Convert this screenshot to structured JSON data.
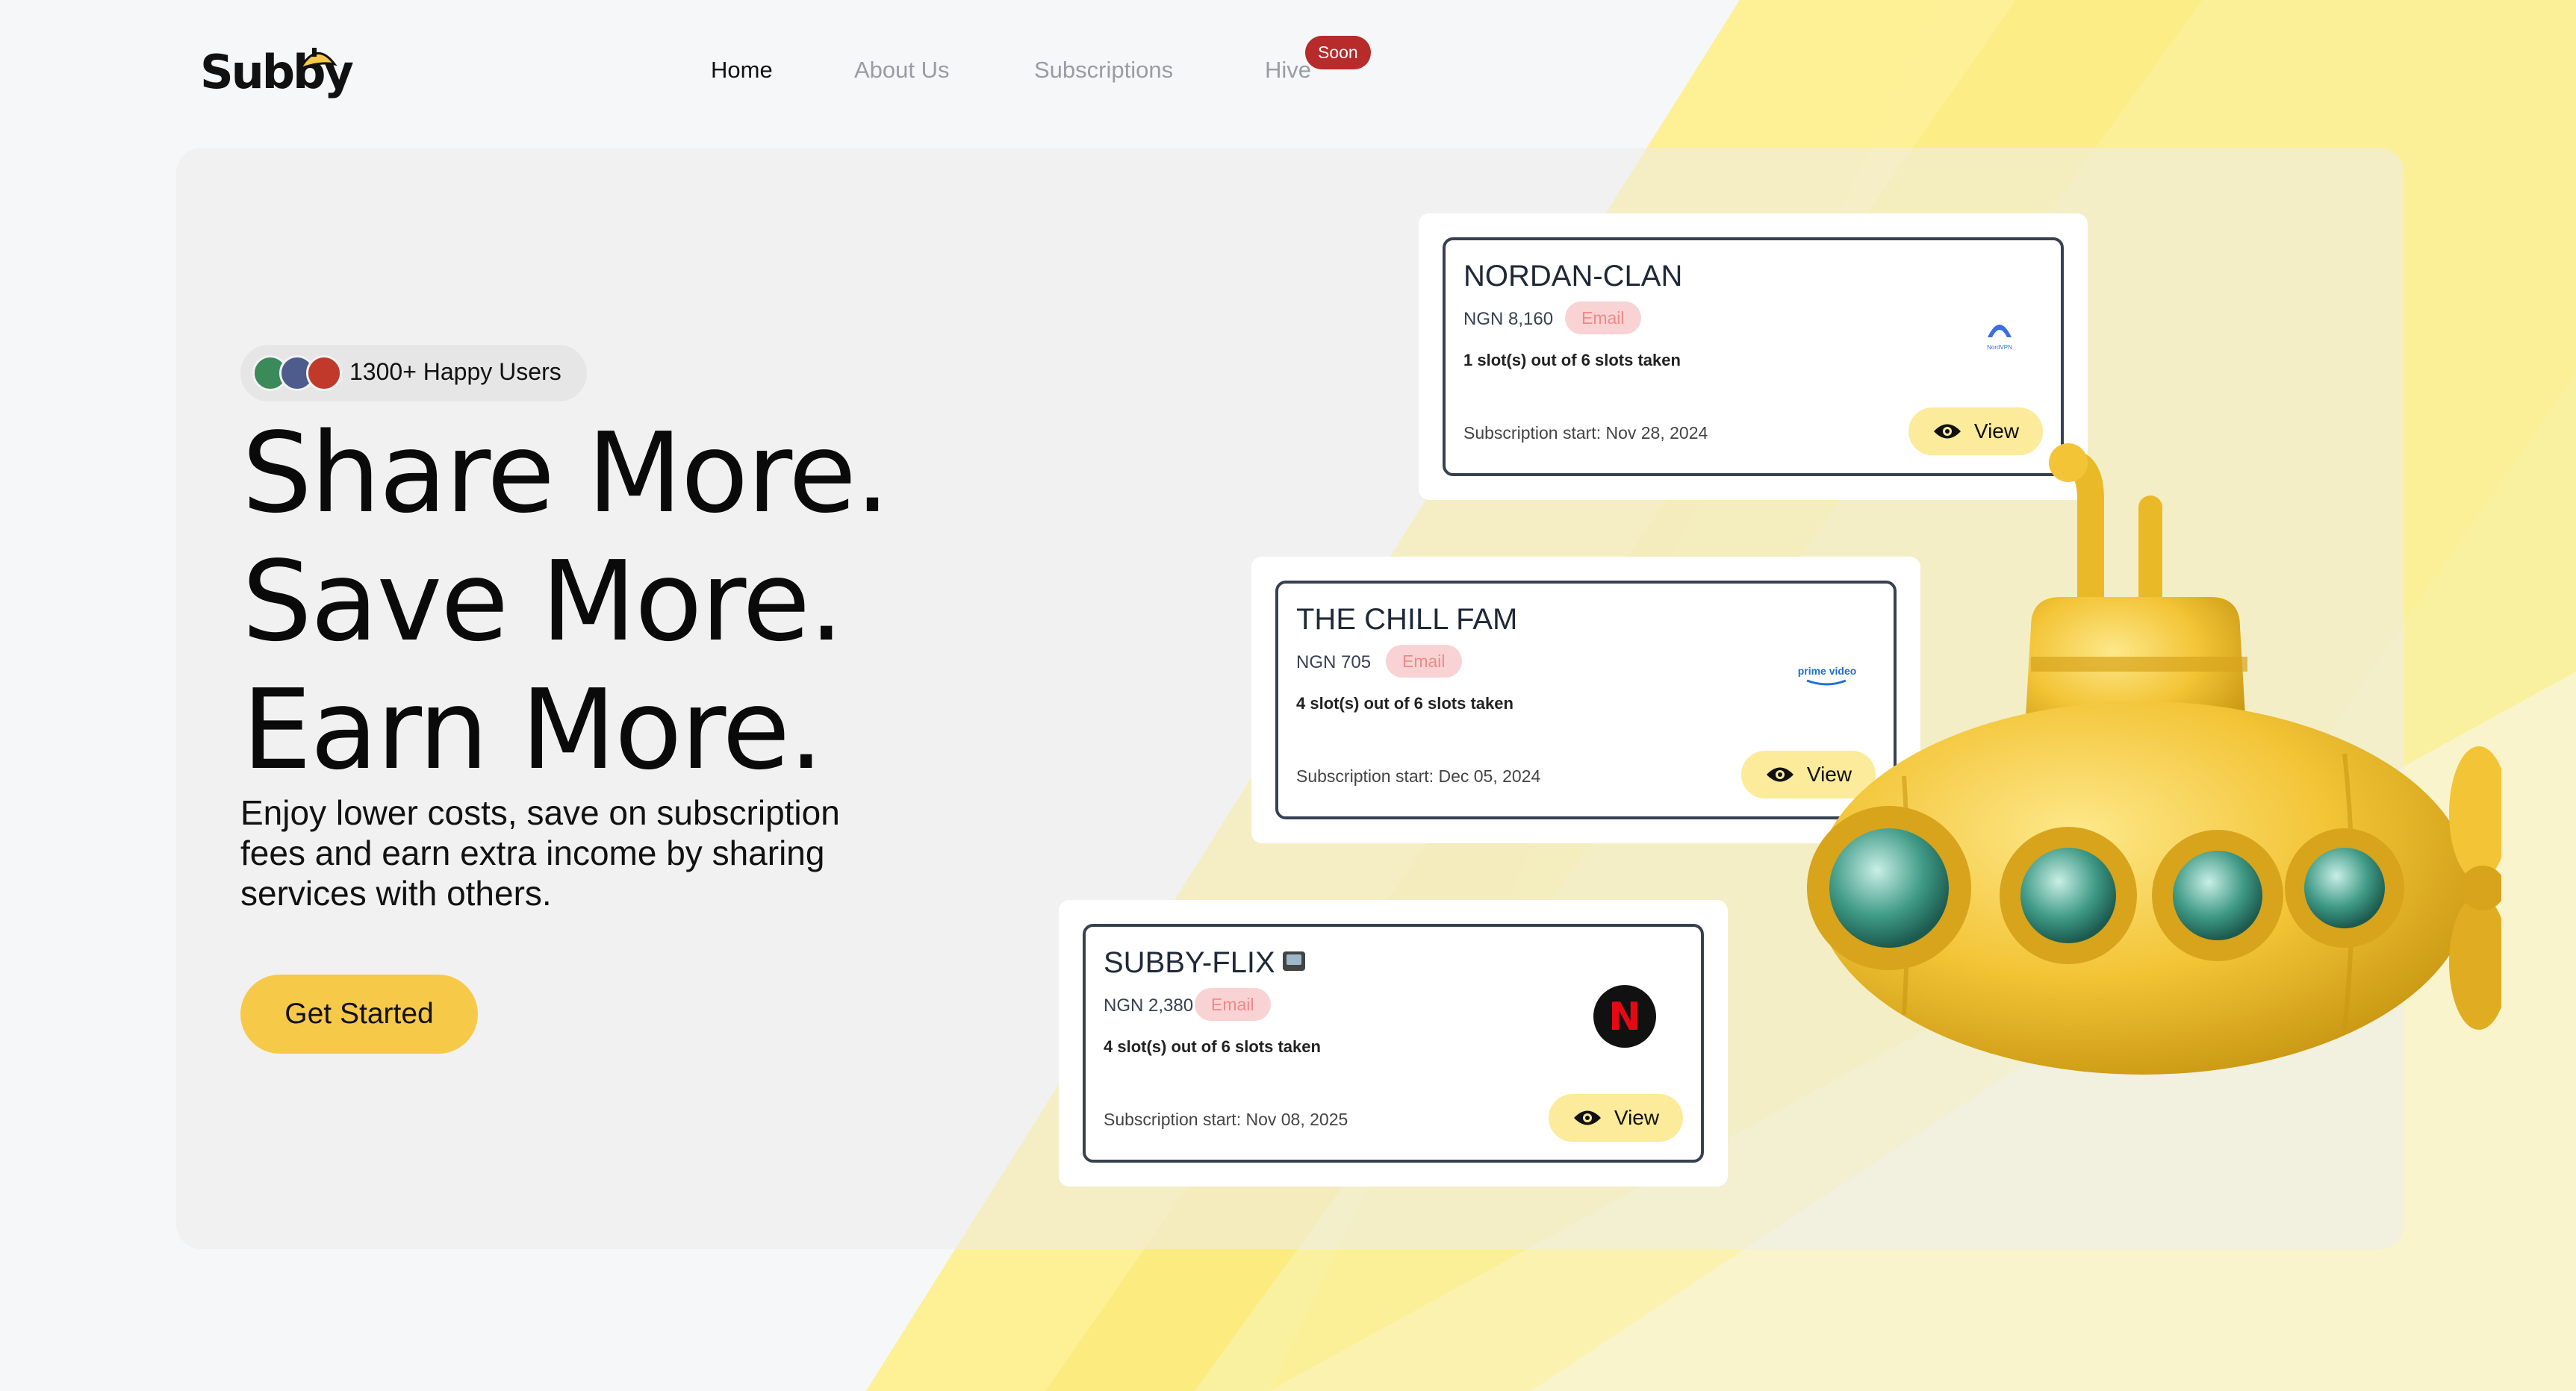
{
  "brand": {
    "name": "Subby"
  },
  "nav": {
    "items": [
      {
        "label": "Home",
        "active": true
      },
      {
        "label": "About Us",
        "active": false
      },
      {
        "label": "Subscriptions",
        "active": false
      },
      {
        "label": "Hive",
        "active": false
      }
    ],
    "badge": "Soon"
  },
  "hero": {
    "users_label": "1300+ Happy Users",
    "headline": [
      "Share More.",
      "Save More.",
      "Earn More."
    ],
    "subtext": "Enjoy lower costs, save on subscription fees and earn extra income by sharing services with others.",
    "cta_label": "Get Started"
  },
  "cards": [
    {
      "title": "NORDAN-CLAN",
      "price": "NGN 8,160",
      "tag": "Email",
      "slots": "1 slot(s) out of 6 slots taken",
      "start": "Subscription start: Nov 28, 2024",
      "view_label": "View",
      "logo": "nordvpn-logo",
      "logo_text": "NordVPN"
    },
    {
      "title": "THE CHILL FAM",
      "price": "NGN 705",
      "tag": "Email",
      "slots": "4 slot(s) out of 6 slots taken",
      "start": "Subscription start: Dec 05, 2024",
      "view_label": "View",
      "logo": "prime-video-logo",
      "logo_text": "prime video"
    },
    {
      "title": "SUBBY-FLIX",
      "price": "NGN 2,380",
      "tag": "Email",
      "slots": "4 slot(s) out of 6 slots taken",
      "start": "Subscription start: Nov 08, 2025",
      "view_label": "View",
      "logo": "netflix-logo",
      "logo_text": "N"
    }
  ],
  "colors": {
    "accent": "#f7c948",
    "tag_bg": "#f9d3d3",
    "tag_text": "#ee8a8a",
    "badge": "#b72b2b",
    "view_bg": "#fbeb9a"
  }
}
